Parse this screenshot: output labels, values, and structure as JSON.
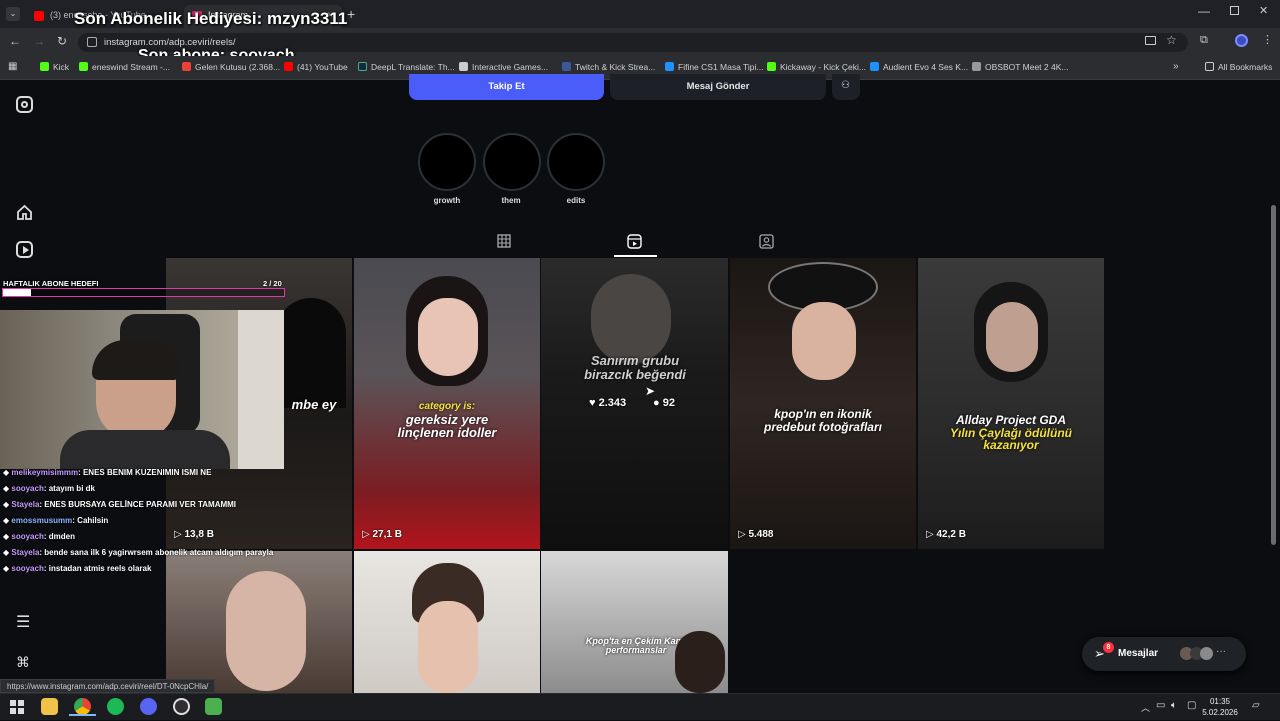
{
  "overlay": {
    "gift_text": "Son Abonelik Hediyesi: mzyn3311",
    "sub_text": "Son abone: sooyach",
    "goal_label": "HAFTALIK ABONE HEDEFI",
    "goal_count": "2",
    "goal_total": "/ 20",
    "goal_fraction": 0.1,
    "chat": [
      {
        "user": "melikeymisimmm",
        "msg": ": ENES BENIM KUZENIMIN ISMI NE"
      },
      {
        "user": "sooyach",
        "msg": ": atayım bi dk"
      },
      {
        "user": "Stayela",
        "msg": ": ENES BURSAYA GELİNCE PARAMI VER TAMAMMI"
      },
      {
        "user": "emossmusumm",
        "msg": ": Cahilsin"
      },
      {
        "user": "sooyach",
        "msg": ": dmden"
      },
      {
        "user": "Stayela",
        "msg": ": bende sana ilk 6 yagirwrsem abonelik atcam aldıgım parayla"
      },
      {
        "user": "sooyach",
        "msg": ": instadan atmis reels olarak"
      }
    ]
  },
  "browser": {
    "tabs": [
      {
        "title": "(3) enesseha - YouTube",
        "color": "#ff0000"
      },
      {
        "title": "Instagram",
        "color": "#d62976"
      }
    ],
    "new_tab": "+",
    "url": "instagram.com/adp.ceviri/reels/",
    "bookmarks": [
      {
        "label": "Kick",
        "color": "#53fc18"
      },
      {
        "label": "eneswind Stream -...",
        "color": "#53fc18"
      },
      {
        "label": "Gelen Kutusu (2.368...",
        "color": "#ea4335"
      },
      {
        "label": "(41) YouTube",
        "color": "#ff0000"
      },
      {
        "label": "DeepL Translate: Th...",
        "color": "#0f2b46"
      },
      {
        "label": "Interactive Games...",
        "color": "#cccccc"
      },
      {
        "label": "Twitch & Kick Strea...",
        "color": "#3b5998"
      },
      {
        "label": "Fifine CS1 Masa Tipi...",
        "color": "#1e90ff"
      },
      {
        "label": "Kickaway - Kick Çeki...",
        "color": "#53fc18"
      },
      {
        "label": "Audient Evo 4 Ses K...",
        "color": "#1e90ff"
      },
      {
        "label": "OBSBOT Meet 2 4K...",
        "color": "#999999"
      }
    ],
    "all_bookmarks": "All Bookmarks",
    "status_url": "https://www.instagram.com/adp.ceviri/reel/DT-0NcpCHla/"
  },
  "profile": {
    "follow_label": "Takip Et",
    "message_label": "Mesaj Gönder",
    "highlights": [
      "growth",
      "them",
      "edits"
    ]
  },
  "reels": [
    {
      "views": "13,8 B",
      "caption": "mbe ey"
    },
    {
      "views": "27,1 B",
      "caption_a": "category is:",
      "caption_b": "gereksiz yere linçlenen idoller"
    },
    {
      "likes": "2.343",
      "comments": "92",
      "caption": "Sanırım grubu birazcık beğendi"
    },
    {
      "views": "5.488",
      "caption_a": "kpop'ın en ikonik",
      "caption_b": "predebut fotoğrafları"
    },
    {
      "views": "42,2 B",
      "caption_a": "Allday Project GDA",
      "caption_b": "Yılın Çaylağı ödülünü kazanıyor"
    },
    {
      "views": ""
    },
    {
      "views": ""
    },
    {
      "views": "",
      "caption": "Kpop'ta en Çekim Kanlı performanslar"
    }
  ],
  "messages": {
    "label": "Mesajlar",
    "badge": "8"
  },
  "taskbar": {
    "time": "01:35",
    "date": "5.02.2026"
  }
}
